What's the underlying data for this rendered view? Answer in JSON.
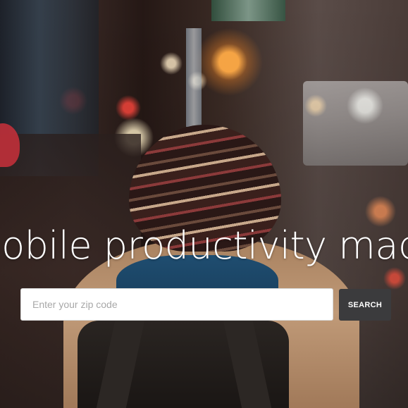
{
  "hero": {
    "headline": "Mobile productivity made easy",
    "background_description_icon": "city-night-photo"
  },
  "search": {
    "placeholder": "Enter your zip code",
    "value": "",
    "button_label": "SEARCH"
  },
  "colors": {
    "button_bg": "#3b3b3d",
    "input_bg": "#ffffff",
    "headline": "#ffffff"
  }
}
